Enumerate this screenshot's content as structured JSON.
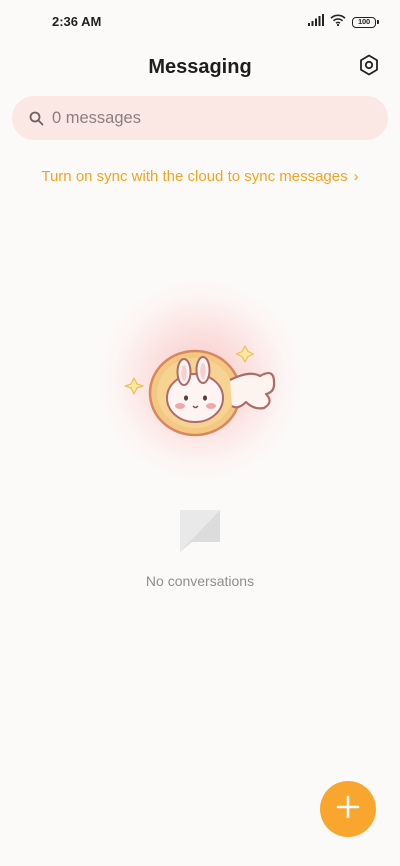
{
  "status_bar": {
    "time": "2:36 AM",
    "battery": "100",
    "icons": [
      "signal-icon",
      "wifi-icon",
      "battery-icon"
    ]
  },
  "header": {
    "title": "Messaging",
    "settings_icon": "gear-icon"
  },
  "search": {
    "placeholder": "0 messages",
    "icon": "search-icon"
  },
  "sync": {
    "label": "Turn on sync with the cloud to sync messages",
    "chevron": "›"
  },
  "empty_state": {
    "label": "No conversations",
    "illustration": "bunny-illustration",
    "icon": "chat-bubble-icon"
  },
  "fab": {
    "icon": "plus-icon",
    "color": "#f9a62f"
  },
  "colors": {
    "accent": "#f0a521",
    "search_bg": "#fbe7e3",
    "background": "#fcfaf9"
  }
}
